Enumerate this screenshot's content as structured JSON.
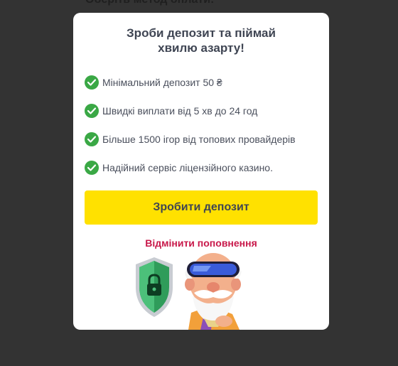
{
  "background": {
    "heading_partial": "Оберіть метод оплати:"
  },
  "modal": {
    "title_line1": "Зроби депозит та піймай",
    "title_line2": "хвилю азарту!",
    "features": [
      {
        "icon": "check-circle-icon",
        "text": "Мінімальний депозит 50 ₴"
      },
      {
        "icon": "check-circle-icon",
        "text": "Швидкі виплати від 5 хв до 24 год"
      },
      {
        "icon": "check-circle-icon",
        "text": "Більше 1500 ігор від топових провайдерів"
      },
      {
        "icon": "check-circle-icon",
        "text": "Надійний сервіс ліцензійного казино."
      }
    ],
    "primary_button": "Зробити депозит",
    "cancel_link": "Відмінити поповнення",
    "illustration": "mascot-with-shield"
  },
  "colors": {
    "overlay": "#333333",
    "accent_yellow": "#ffe100",
    "check_green": "#3aa845",
    "cancel_red": "#c8184a",
    "text_dark": "#3f4553"
  }
}
